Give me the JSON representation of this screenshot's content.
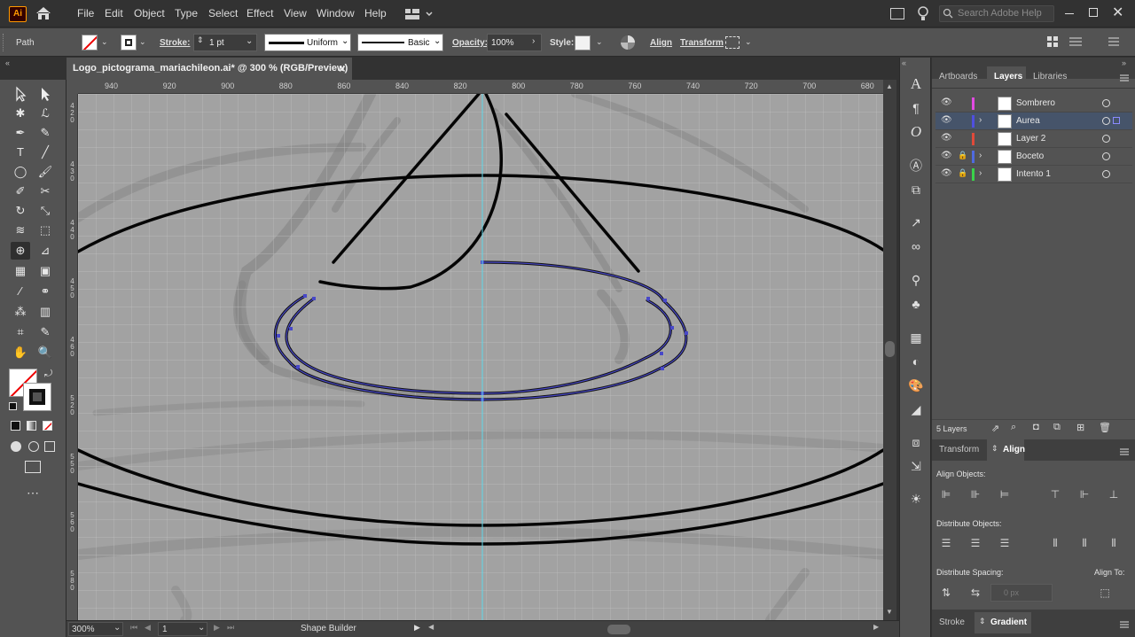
{
  "app": {
    "logo": "Ai"
  },
  "menu": [
    "File",
    "Edit",
    "Object",
    "Type",
    "Select",
    "Effect",
    "View",
    "Window",
    "Help"
  ],
  "search": {
    "placeholder": "Search Adobe Help"
  },
  "control_bar": {
    "selection_type": "Path",
    "stroke_label": "Stroke:",
    "stroke_weight": "1 pt",
    "profile_uniform": "Uniform",
    "brush_basic": "Basic",
    "opacity_label": "Opacity:",
    "opacity_value": "100%",
    "style_label": "Style:",
    "align_label": "Align",
    "transform_label": "Transform"
  },
  "document": {
    "tab_title": "Logo_pictograma_mariachileon.ai* @ 300 % (RGB/Preview)",
    "close_glyph": "×"
  },
  "ruler": {
    "horizontal": [
      "940",
      "920",
      "900",
      "880",
      "860",
      "840",
      "820",
      "800",
      "780",
      "760",
      "740",
      "720",
      "700",
      "680"
    ],
    "vertical": [
      "4 2 0",
      "4 3 0",
      "4 4 0",
      "4 5 0",
      "4 6 0",
      "5 2 0",
      "5 5 0",
      "5 6 0",
      "5 8 0"
    ]
  },
  "status_bar": {
    "zoom": "300%",
    "artboard": "1",
    "tool": "Shape Builder"
  },
  "panel_tabs": {
    "artboards": "Artboards",
    "layers": "Layers",
    "libraries": "Libraries"
  },
  "layers": [
    {
      "name": "Sombrero",
      "color": "#e24ae2",
      "locked": false,
      "expandable": false,
      "selected": false
    },
    {
      "name": "Aurea",
      "color": "#4f4fe0",
      "locked": false,
      "expandable": true,
      "selected": true
    },
    {
      "name": "Layer 2",
      "color": "#e04a3a",
      "locked": false,
      "expandable": false,
      "selected": false
    },
    {
      "name": "Boceto",
      "color": "#4f6ae0",
      "locked": true,
      "expandable": true,
      "selected": false
    },
    {
      "name": "Intento 1",
      "color": "#3ad24a",
      "locked": true,
      "expandable": true,
      "selected": false
    }
  ],
  "layers_count": "5 Layers",
  "align_panel": {
    "tab_transform": "Transform",
    "tab_align": "Align",
    "align_objects": "Align Objects:",
    "distribute_objects": "Distribute Objects:",
    "distribute_spacing": "Distribute Spacing:",
    "align_to": "Align To:",
    "spacing_value": "0 px"
  },
  "bottom_tabs": {
    "stroke": "Stroke",
    "gradient": "Gradient"
  },
  "colors": {
    "accent_guide": "#5fd8ea",
    "selection_path": "#4848c8",
    "layer_selected": "#46546a"
  }
}
